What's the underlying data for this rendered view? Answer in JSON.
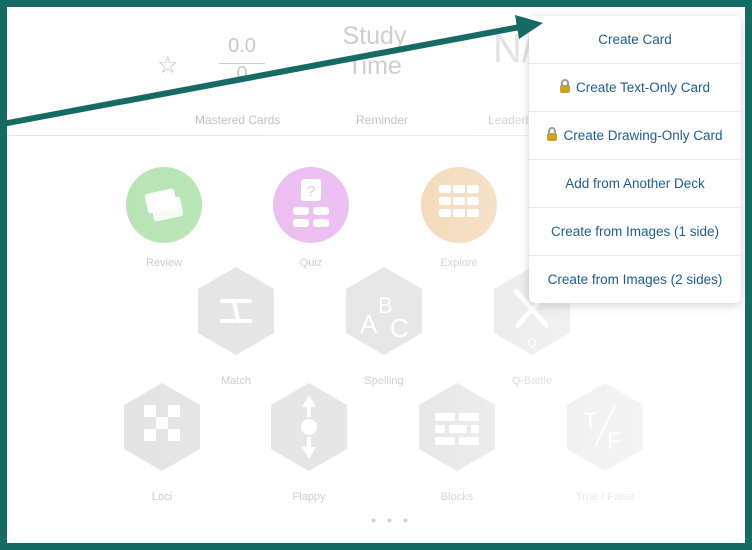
{
  "stats": {
    "star_glyph": "☆",
    "mastered_top": "0.0",
    "mastered_bottom": "0",
    "mastered_label": "Mastered Cards",
    "study_time": "Study Time",
    "reminder_label": "Reminder",
    "na_value": "N/A",
    "leaderboard_label": "Leaderb"
  },
  "apps_row1": [
    {
      "label": "Review",
      "color": "#b4e3b2"
    },
    {
      "label": "Quiz",
      "color": "#eab8ef"
    },
    {
      "label": "Explore",
      "color": "#f2d3ad"
    }
  ],
  "apps_row2": [
    {
      "label": "Match"
    },
    {
      "label": "Spelling"
    },
    {
      "label": "Q-Battle"
    }
  ],
  "apps_row3": [
    {
      "label": "Loci"
    },
    {
      "label": "Flappy"
    },
    {
      "label": "Blocks"
    },
    {
      "label": "True / False"
    }
  ],
  "menu": {
    "items": [
      {
        "label": "Create Card",
        "locked": false
      },
      {
        "label": "Create Text-Only Card",
        "locked": true
      },
      {
        "label": "Create Drawing-Only Card",
        "locked": true
      },
      {
        "label": "Add from Another Deck",
        "locked": false
      },
      {
        "label": "Create from Images (1 side)",
        "locked": false
      },
      {
        "label": "Create from Images (2 sides)",
        "locked": false
      }
    ]
  },
  "pager": "● ● ●",
  "colors": {
    "frame": "#166a64",
    "arrow": "#166a64",
    "menu_text": "#1f5d8a"
  }
}
